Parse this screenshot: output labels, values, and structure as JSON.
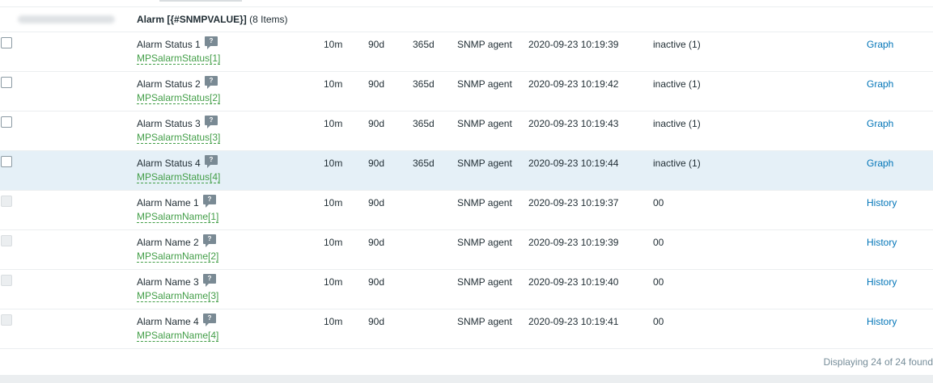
{
  "group": {
    "title": "Alarm [{#SNMPVALUE}]",
    "count": "(8 Items)"
  },
  "rows": [
    {
      "name": "Alarm Status 1",
      "key": "MPSalarmStatus[1]",
      "interval": "10m",
      "history": "90d",
      "trends": "365d",
      "type": "SNMP agent",
      "last_check": "2020-09-23 10:19:39",
      "last_value": "inactive (1)",
      "link": "Graph",
      "disabled": false,
      "highlighted": false
    },
    {
      "name": "Alarm Status 2",
      "key": "MPSalarmStatus[2]",
      "interval": "10m",
      "history": "90d",
      "trends": "365d",
      "type": "SNMP agent",
      "last_check": "2020-09-23 10:19:42",
      "last_value": "inactive (1)",
      "link": "Graph",
      "disabled": false,
      "highlighted": false
    },
    {
      "name": "Alarm Status 3",
      "key": "MPSalarmStatus[3]",
      "interval": "10m",
      "history": "90d",
      "trends": "365d",
      "type": "SNMP agent",
      "last_check": "2020-09-23 10:19:43",
      "last_value": "inactive (1)",
      "link": "Graph",
      "disabled": false,
      "highlighted": false
    },
    {
      "name": "Alarm Status 4",
      "key": "MPSalarmStatus[4]",
      "interval": "10m",
      "history": "90d",
      "trends": "365d",
      "type": "SNMP agent",
      "last_check": "2020-09-23 10:19:44",
      "last_value": "inactive (1)",
      "link": "Graph",
      "disabled": false,
      "highlighted": true
    },
    {
      "name": "Alarm Name 1",
      "key": "MPSalarmName[1]",
      "interval": "10m",
      "history": "90d",
      "trends": "",
      "type": "SNMP agent",
      "last_check": "2020-09-23 10:19:37",
      "last_value": "00",
      "link": "History",
      "disabled": true,
      "highlighted": false
    },
    {
      "name": "Alarm Name 2",
      "key": "MPSalarmName[2]",
      "interval": "10m",
      "history": "90d",
      "trends": "",
      "type": "SNMP agent",
      "last_check": "2020-09-23 10:19:39",
      "last_value": "00",
      "link": "History",
      "disabled": true,
      "highlighted": false
    },
    {
      "name": "Alarm Name 3",
      "key": "MPSalarmName[3]",
      "interval": "10m",
      "history": "90d",
      "trends": "",
      "type": "SNMP agent",
      "last_check": "2020-09-23 10:19:40",
      "last_value": "00",
      "link": "History",
      "disabled": true,
      "highlighted": false
    },
    {
      "name": "Alarm Name 4",
      "key": "MPSalarmName[4]",
      "interval": "10m",
      "history": "90d",
      "trends": "",
      "type": "SNMP agent",
      "last_check": "2020-09-23 10:19:41",
      "last_value": "00",
      "link": "History",
      "disabled": true,
      "highlighted": false
    }
  ],
  "help_glyph": "?",
  "footer": {
    "text": "Displaying 24 of 24 found"
  },
  "colors": {
    "link": "#0275b8",
    "item_key": "#429e47",
    "highlight_row": "#e5f0f7"
  }
}
